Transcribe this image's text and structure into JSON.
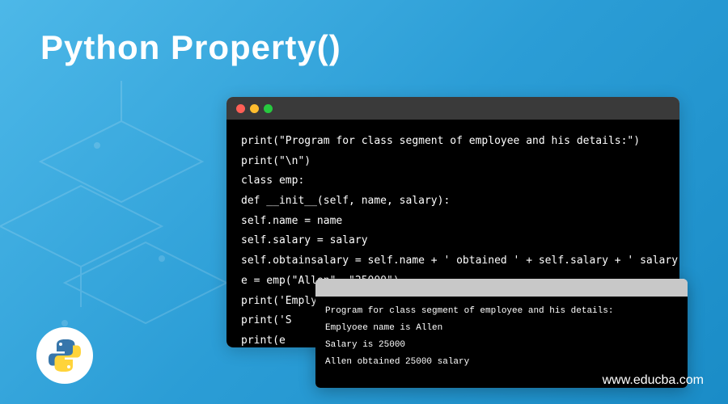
{
  "title": "Python Property()",
  "code_window": {
    "lines": [
      "print(\"Program for class segment of employee and his details:\")",
      "print(\"\\n\")",
      "class emp:",
      "def __init__(self, name, salary):",
      "self.name = name",
      "self.salary = salary",
      "self.obtainsalary = self.name + ' obtained ' + self.salary + ' salary'",
      "e = emp(\"Allen\", \"25000\")",
      "print('Emplyoee name is ' + e.name)",
      "print('S",
      "print(e"
    ]
  },
  "output_window": {
    "lines": [
      "Program for class segment of employee and his details:",
      "",
      "",
      "Emplyoee name is Allen",
      "Salary is 25000",
      "Allen obtained 25000 salary"
    ]
  },
  "footer": {
    "url": "www.educba.com"
  },
  "colors": {
    "bg_start": "#4db8e8",
    "bg_end": "#1a8cc7",
    "window_black": "#000000",
    "text_white": "#ffffff"
  }
}
